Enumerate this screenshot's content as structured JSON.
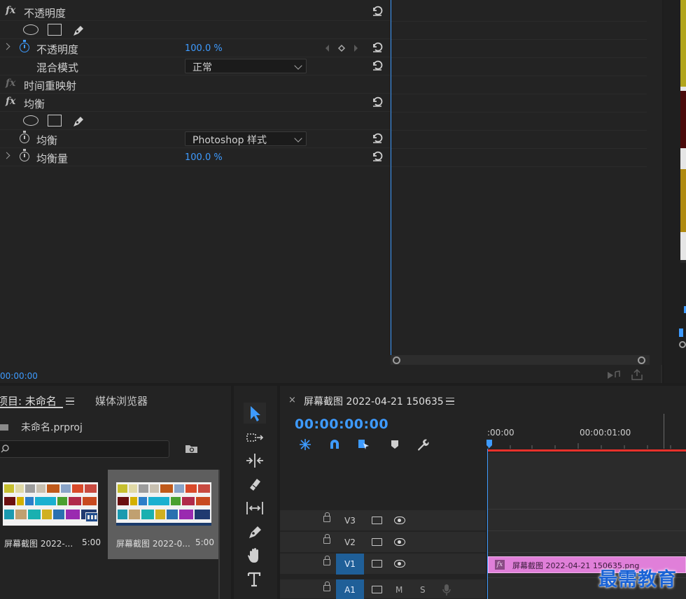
{
  "effects": {
    "opacity_section": "不透明度",
    "opacity_param": "不透明度",
    "opacity_value": "100.0 %",
    "blend_label": "混合模式",
    "blend_value": "正常",
    "time_remap": "时间重映射",
    "equalize_section": "均衡",
    "equalize_param": "均衡",
    "equalize_mode": "Photoshop 样式",
    "equalize_amount_label": "均衡量",
    "equalize_amount_value": "100.0 %",
    "fx_glyph": "fx",
    "timecode": "00:00:00"
  },
  "project": {
    "tab_project": "项目: 未命名",
    "tab_media": "媒体浏览器",
    "file_name": "未命名.prproj",
    "items": [
      {
        "name": "屏幕截图 2022-...",
        "duration": "5:00"
      },
      {
        "name": "屏幕截图 2022-0...",
        "duration": "5:00"
      }
    ]
  },
  "timeline": {
    "close": "×",
    "sequence_name": "屏幕截图 2022-04-21 150635",
    "timecode": "00:00:00:00",
    "ruler": [
      ":00:00",
      "00:00:01:00"
    ],
    "tracks": [
      {
        "name": "V3",
        "active": false
      },
      {
        "name": "V2",
        "active": false
      },
      {
        "name": "V1",
        "active": true
      },
      {
        "name": "A1",
        "active": true
      }
    ],
    "audio_m": "M",
    "audio_s": "S",
    "clip_fx": "fx",
    "clip_name": "屏幕截图 2022-04-21 150635.png"
  },
  "watermark": "最需教育",
  "colors": {
    "accent": "#3e9bff",
    "clip": "#e07fd9",
    "playhead": "#e8312a"
  }
}
